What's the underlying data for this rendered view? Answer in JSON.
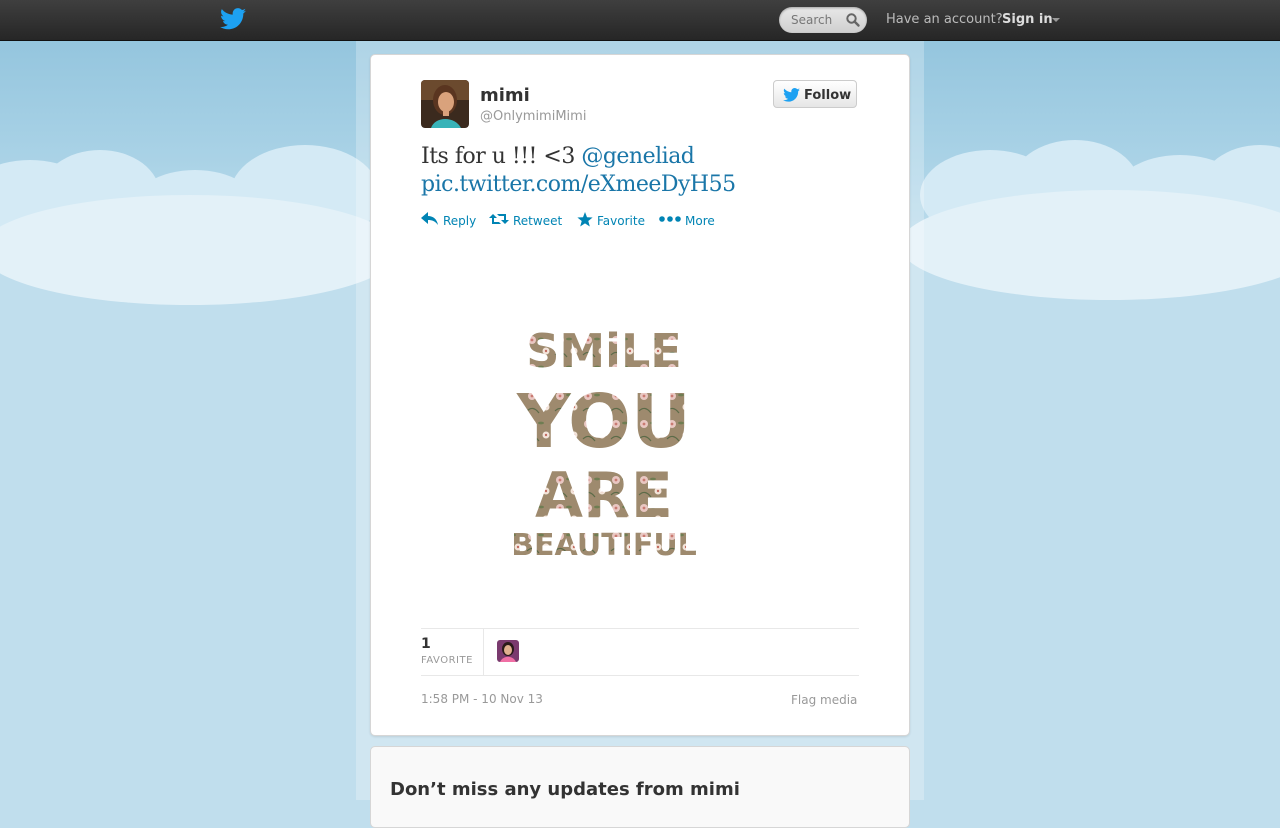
{
  "topbar": {
    "search_placeholder": "Search",
    "have_account": "Have an account?",
    "sign_in": "Sign in"
  },
  "tweet": {
    "name": "mimi",
    "handle": "@OnlymimiMimi",
    "follow_label": "Follow",
    "text_prefix": "Its for u !!! <3 ",
    "mention": "@geneliad",
    "link": "pic.twitter.com/eXmeeDyH55",
    "actions": {
      "reply": "Reply",
      "retweet": "Retweet",
      "favorite": "Favorite",
      "more": "More"
    },
    "media_text": {
      "line1": "SMiLE",
      "line2": "YOU",
      "line3": "ARE",
      "line4": "BEAUTIFUL"
    },
    "favorites_count": "1",
    "favorites_label": "FAVORITE",
    "timestamp": "1:58 PM - 10 Nov 13",
    "flag_media": "Flag media"
  },
  "signup_card": {
    "title": "Don’t miss any updates from mimi"
  },
  "colors": {
    "link": "#0084b4",
    "twitter_blue": "#1da1f2",
    "topbar": "#2e2e2e"
  }
}
